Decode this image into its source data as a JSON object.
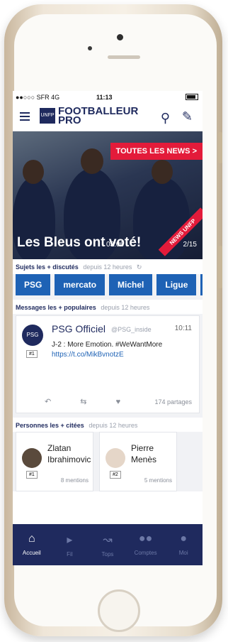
{
  "status": {
    "carrier": "●●○○○ SFR 4G",
    "time": "11:13"
  },
  "app": {
    "brand_badge": "UNFP",
    "brand_name": "FOOTBALLEUR PRO"
  },
  "hero": {
    "news_button": "TOUTES LES NEWS >",
    "title": "Les Bleus ont voté!",
    "duration": "03:06",
    "counter": "2/15",
    "ribbon": "NEWS UNFP"
  },
  "topics": {
    "heading": "Sujets les + discutés",
    "since": "depuis 12 heures",
    "chips": [
      "PSG",
      "mercato",
      "Michel",
      "Ligue",
      "Ma"
    ]
  },
  "messages": {
    "heading": "Messages les + populaires",
    "since": "depuis 12 heures",
    "tweet": {
      "avatar": "PSG",
      "rank": "#1",
      "name": "PSG Officiel",
      "handle": "@PSG_inside",
      "time": "10:11",
      "text": "J-2 : More Emotion. #WeWantMore",
      "link": "https://t.co/MikBvnotzE",
      "shares": "174 partages"
    }
  },
  "people": {
    "heading": "Personnes les + citées",
    "since": "depuis 12 heures",
    "items": [
      {
        "name": "Zlatan Ibrahimovic",
        "rank": "#1",
        "mentions": "8 mentions"
      },
      {
        "name": "Pierre Menès",
        "rank": "#2",
        "mentions": "5 mentions"
      }
    ]
  },
  "tabs": [
    {
      "label": "Accueil",
      "icon": "home-icon"
    },
    {
      "label": "Fil",
      "icon": "megaphone-icon"
    },
    {
      "label": "Tops",
      "icon": "trend-icon"
    },
    {
      "label": "Comptes",
      "icon": "users-icon"
    },
    {
      "label": "Moi",
      "icon": "user-icon"
    }
  ],
  "colors": {
    "navy": "#1f2a5e",
    "chip_blue": "#1e62b5",
    "accent_red": "#e31b3a"
  }
}
